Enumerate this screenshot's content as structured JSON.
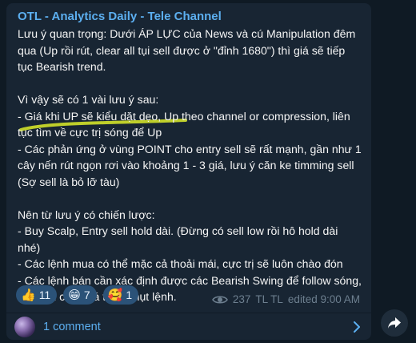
{
  "post": {
    "channel_name": "OTL - Analytics Daily - Tele Channel",
    "lines": [
      "Lưu ý quan trọng: Dưới ÁP LỰC của News và cú Manipulation đêm",
      "qua (Up rồi rút, clear all tụi sell được ở \"đỉnh 1680\") thì giá sẽ tiếp",
      "tục Bearish trend.",
      "",
      "Vì vậy sẽ có 1 vài lưu ý sau:",
      "- Giá khi UP sẽ kiểu dặt dẹo, Up theo channel or compression, liên",
      "tục tìm về cực trị sóng để Up",
      "- Các phản ứng ở vùng POINT cho entry sell sẽ rất mạnh, gần như 1",
      "cây nến rút ngọn rơi vào khoảng 1 - 3 giá, lưu ý căn ke timming sell",
      "(Sợ sell là bỏ lỡ tàu)",
      "",
      "Nên từ lưu ý có chiến lược:",
      "- Buy Scalp, Entry sell hold dài. (Đừng có sell low rồi hô hold dài",
      "nhé)",
      "- Các lệnh mua có thể mặc cả thoải mái, cực trị sẽ luôn chào đón",
      "- Các lệnh bán cần xác định được các Bearish Swing để follow sóng,",
      "chờ đợi cao quá thì sẽ hụt lệnh."
    ],
    "reactions": [
      {
        "emoji": "👍",
        "count": "11"
      },
      {
        "emoji": "😁",
        "count": "7"
      },
      {
        "emoji": "🥰",
        "count": "1"
      }
    ],
    "views": "237",
    "author": "TL TL",
    "edited_time": "edited 9:00 AM",
    "comments_label": "1 comment"
  },
  "colors": {
    "bubble": "#182533",
    "channel_name": "#5caff0",
    "highlight": "#c8d82a",
    "reaction_bg": "#2b5278"
  },
  "icons": {
    "views": "eye-icon",
    "comments_arrow": "chevron-right-icon",
    "share": "share-arrow-icon"
  }
}
